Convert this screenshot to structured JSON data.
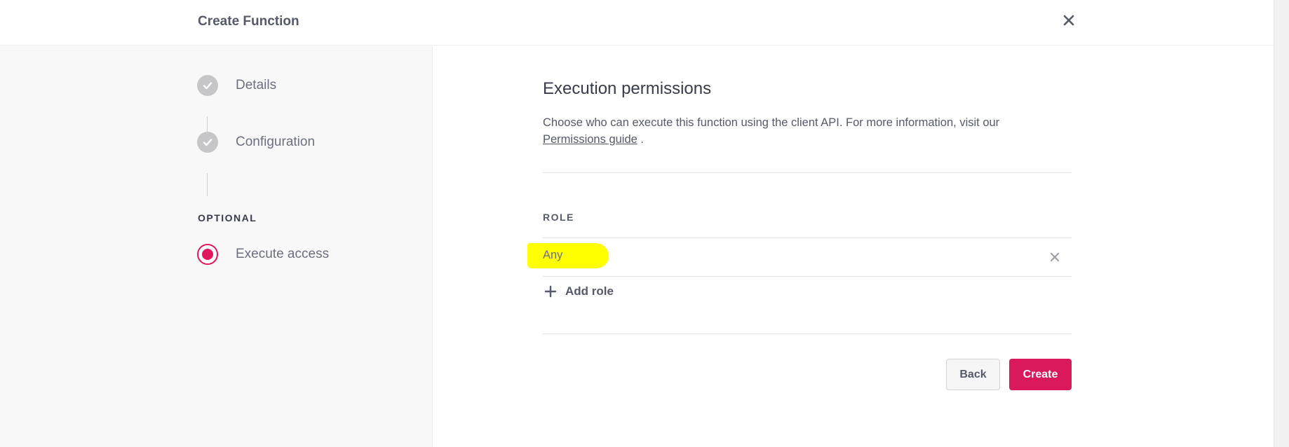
{
  "header": {
    "title": "Create Function",
    "close_icon": "close-icon"
  },
  "sidebar": {
    "steps": [
      {
        "label": "Details",
        "state": "completed",
        "icon": "check-icon"
      },
      {
        "label": "Configuration",
        "state": "completed",
        "icon": "check-icon"
      }
    ],
    "optional_heading": "OPTIONAL",
    "optional_steps": [
      {
        "label": "Execute access",
        "state": "active"
      }
    ]
  },
  "main": {
    "title": "Execution permissions",
    "description": "Choose who can execute this function using the client API. For more information, visit our",
    "guide_link": "Permissions guide",
    "guide_suffix": ".",
    "role_header": "ROLE",
    "roles": [
      {
        "value": "Any",
        "highlighted": true
      }
    ],
    "add_role_label": "Add role",
    "back_label": "Back",
    "create_label": "Create"
  },
  "colors": {
    "accent": "#d9195c",
    "completed_step": "#c6c6c8",
    "highlight": "#ffff00",
    "sidebar_bg": "#f8f8f8"
  }
}
